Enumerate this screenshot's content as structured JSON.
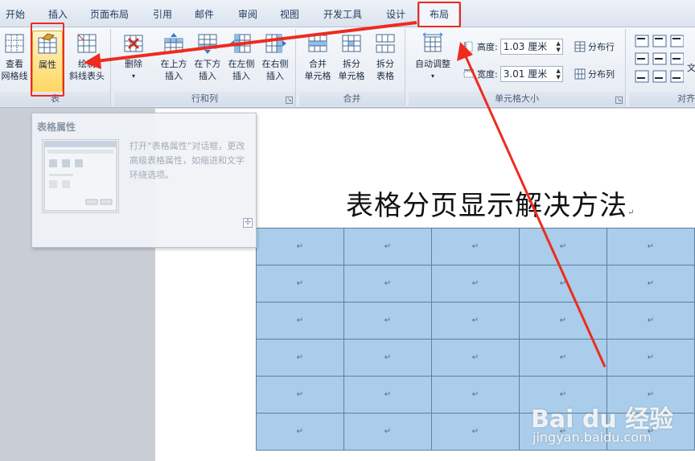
{
  "tabs": [
    {
      "label": "开始"
    },
    {
      "label": "插入"
    },
    {
      "label": "页面布局"
    },
    {
      "label": "引用"
    },
    {
      "label": "邮件"
    },
    {
      "label": "审阅"
    },
    {
      "label": "视图"
    },
    {
      "label": "开发工具"
    },
    {
      "label": "设计"
    },
    {
      "label": "布局"
    }
  ],
  "ribbon": {
    "table_group": {
      "label": "表",
      "view_gridlines": {
        "line1": "查看",
        "line2": "网格线"
      },
      "properties": {
        "label": "属性"
      },
      "draw_diagonal": {
        "line1": "绘制",
        "line2": "斜线表头"
      }
    },
    "rows_cols_group": {
      "label": "行和列",
      "delete": {
        "label": "删除"
      },
      "insert_above": {
        "line1": "在上方",
        "line2": "插入"
      },
      "insert_below": {
        "line1": "在下方",
        "line2": "插入"
      },
      "insert_left": {
        "line1": "在左侧",
        "line2": "插入"
      },
      "insert_right": {
        "line1": "在右侧",
        "line2": "插入"
      }
    },
    "merge_group": {
      "label": "合并",
      "merge_cells": {
        "line1": "合并",
        "line2": "单元格"
      },
      "split_cells": {
        "line1": "拆分",
        "line2": "单元格"
      },
      "split_table": {
        "line1": "拆分",
        "line2": "表格"
      }
    },
    "cell_size_group": {
      "label": "单元格大小",
      "autofit": {
        "label": "自动调整"
      },
      "height_label": "高度:",
      "height_value": "1.03 厘米",
      "width_label": "宽度:",
      "width_value": "3.01 厘米",
      "distribute_rows": "分布行",
      "distribute_cols": "分布列"
    },
    "align_group": {
      "label": "对齐",
      "text_direction_partial": "文"
    }
  },
  "tooltip": {
    "title": "表格属性",
    "body": "打开“表格属性”对话框，更改高级表格属性，如缩进和文字环绕选项。"
  },
  "document": {
    "title": "表格分页显示解决方法",
    "para_mark": "↵",
    "table": {
      "rows": 6,
      "cols": 5,
      "cell_text": "↵"
    }
  },
  "watermark": {
    "logo": "Bai du 经验",
    "url": "jingyan.baidu.com"
  },
  "colors": {
    "annotation_red": "#ee2b1e",
    "table_fill": "#a9cdea",
    "selected_button": "#ffd45a"
  }
}
